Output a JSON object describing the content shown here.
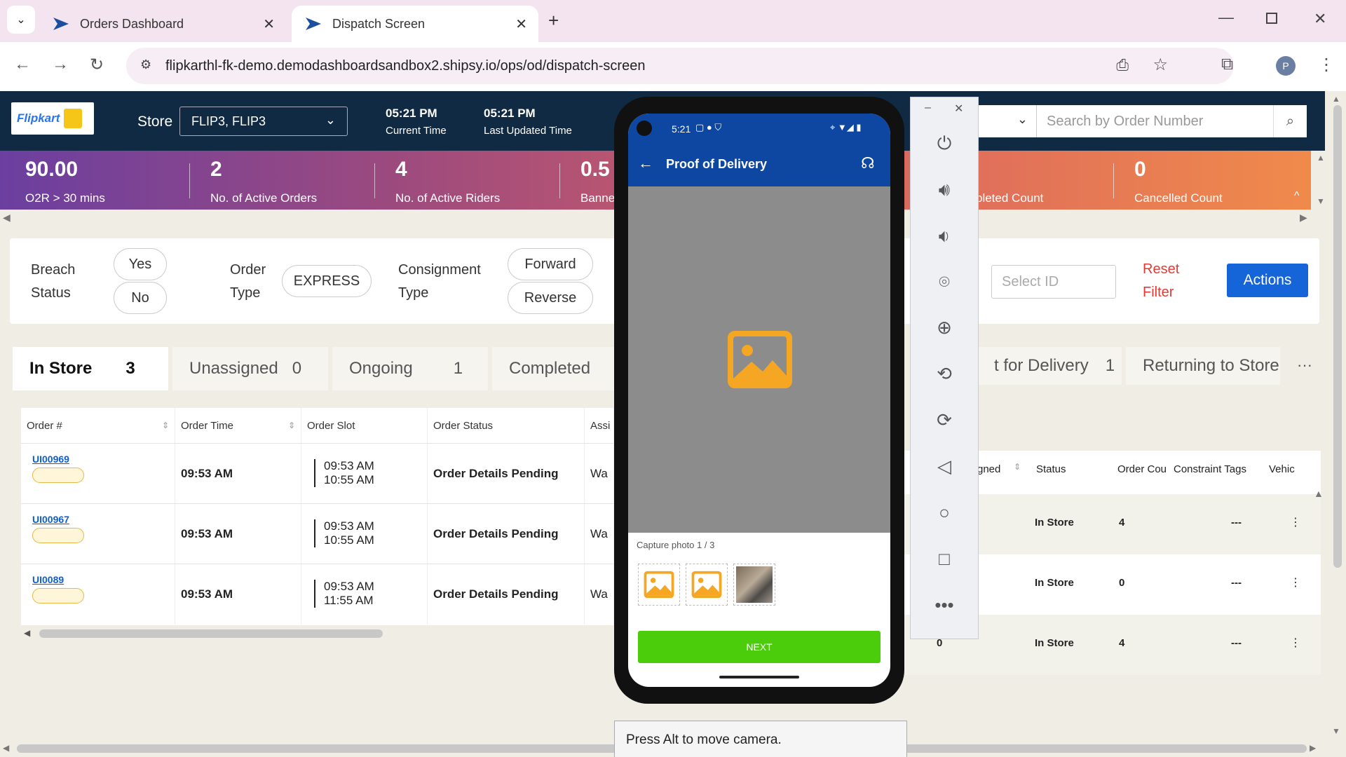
{
  "browser": {
    "tabs": [
      {
        "label": "Orders Dashboard",
        "active": false
      },
      {
        "label": "Dispatch Screen",
        "active": true
      }
    ],
    "url": "flipkarthl-fk-demo.demodashboardsandbox2.shipsy.io/ops/od/dispatch-screen",
    "profile_initial": "P"
  },
  "header": {
    "logo_text": "Flipkart",
    "store_label": "Store",
    "store_value": "FLIP3, FLIP3",
    "current_time": "05:21 PM",
    "current_time_label": "Current Time",
    "last_updated": "05:21 PM",
    "last_updated_label": "Last Updated Time",
    "search_placeholder": "Search by Order Number"
  },
  "metrics": [
    {
      "value": "90.00",
      "label": "O2R > 30 mins"
    },
    {
      "value": "2",
      "label": "No. of Active Orders"
    },
    {
      "value": "4",
      "label": "No. of Active Riders"
    },
    {
      "value": "0.5",
      "label": "Banne"
    },
    {
      "value": "",
      "label": "pleted Count"
    },
    {
      "value": "0",
      "label": "Cancelled Count"
    }
  ],
  "filters": {
    "breach_label_1": "Breach",
    "breach_label_2": "Status",
    "breach_yes": "Yes",
    "breach_no": "No",
    "order_label_1": "Order",
    "order_label_2": "Type",
    "order_express": "EXPRESS",
    "consign_label_1": "Consignment",
    "consign_label_2": "Type",
    "consign_forward": "Forward",
    "consign_reverse": "Reverse",
    "select_id_placeholder": "Select ID",
    "reset_1": "Reset",
    "reset_2": "Filter",
    "actions": "Actions"
  },
  "status_tabs": [
    {
      "label": "In Store",
      "count": "3"
    },
    {
      "label": "Unassigned",
      "count": "0"
    },
    {
      "label": "Ongoing",
      "count": "1"
    },
    {
      "label": "Completed",
      "count": ""
    },
    {
      "label": "t for Delivery",
      "count": "1"
    },
    {
      "label": "Returning to Store",
      "count": ""
    }
  ],
  "more_tabs": "···",
  "table": {
    "headers": [
      "Order #",
      "Order Time",
      "Order Slot",
      "Order Status",
      "Assi"
    ],
    "rows": [
      {
        "order": "UI00969",
        "time": "09:53 AM",
        "slot_start": "09:53 AM",
        "slot_end": "10:55 AM",
        "status": "Order Details Pending",
        "assigned": "Wa"
      },
      {
        "order": "UI00967",
        "time": "09:53 AM",
        "slot_start": "09:53 AM",
        "slot_end": "10:55 AM",
        "status": "Order Details Pending",
        "assigned": "Wa"
      },
      {
        "order": "UI0089",
        "time": "09:53 AM",
        "slot_start": "09:53 AM",
        "slot_end": "11:55 AM",
        "status": "Order Details Pending",
        "assigned": "Wa"
      }
    ]
  },
  "right_table": {
    "headers": [
      "gned",
      "Status",
      "Order Cou",
      "Constraint Tags",
      "Vehic"
    ],
    "rows": [
      {
        "assigned": "",
        "status": "In Store",
        "count": "4",
        "tags": "---"
      },
      {
        "assigned": "",
        "status": "In Store",
        "count": "0",
        "tags": "---"
      },
      {
        "assigned": "0",
        "status": "In Store",
        "count": "4",
        "tags": "---"
      }
    ]
  },
  "phone": {
    "time": "5:21",
    "title": "Proof of Delivery",
    "capture_label": "Capture photo 1 / 3",
    "next_label": "NEXT"
  },
  "tooltip": "Press Alt to move camera.",
  "colors": {
    "header_bg": "#102a43",
    "accent_blue": "#1565d8",
    "reset_red": "#e53935",
    "next_green": "#4ccd0b",
    "placeholder_icon": "#f5a623"
  }
}
